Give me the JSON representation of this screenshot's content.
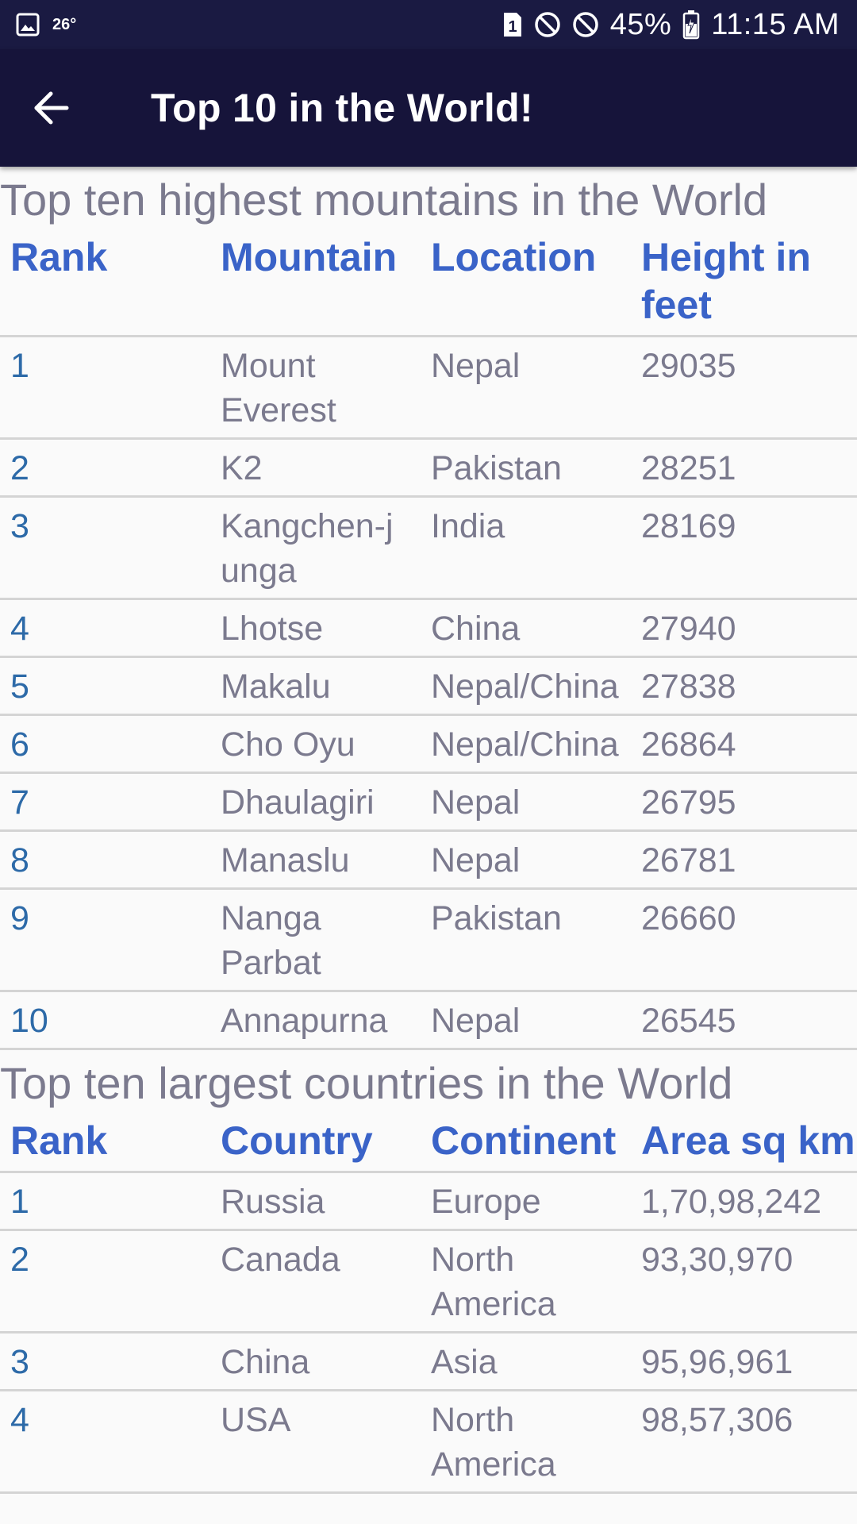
{
  "status_bar": {
    "temperature": "26°",
    "sim_badge": "1",
    "battery": "45%",
    "time": "11:15 AM"
  },
  "app_bar": {
    "title": "Top 10 in the World!"
  },
  "mountains": {
    "title": "Top ten highest mountains in the World",
    "headers": [
      "Rank",
      "Mountain",
      "Location",
      "Height in feet"
    ],
    "rows": [
      [
        "1",
        "Mount Everest",
        "Nepal",
        "29035"
      ],
      [
        "2",
        "K2",
        "Pakistan",
        "28251"
      ],
      [
        "3",
        "Kangchen-junga",
        "India",
        "28169"
      ],
      [
        "4",
        "Lhotse",
        "China",
        "27940"
      ],
      [
        "5",
        "Makalu",
        "Nepal/China",
        "27838"
      ],
      [
        "6",
        "Cho Oyu",
        "Nepal/China",
        "26864"
      ],
      [
        "7",
        "Dhaulagiri",
        "Nepal",
        "26795"
      ],
      [
        "8",
        "Manaslu",
        "Nepal",
        "26781"
      ],
      [
        "9",
        "Nanga Parbat",
        "Pakistan",
        "26660"
      ],
      [
        "10",
        "Annapurna",
        "Nepal",
        "26545"
      ]
    ]
  },
  "countries": {
    "title": "Top ten largest countries in the World",
    "headers": [
      "Rank",
      "Country",
      "Continent",
      "Area sq km"
    ],
    "rows": [
      [
        "1",
        "Russia",
        "Europe",
        "1,70,98,242"
      ],
      [
        "2",
        "Canada",
        "North America",
        "93,30,970"
      ],
      [
        "3",
        "China",
        "Asia",
        "95,96,961"
      ],
      [
        "4",
        "USA",
        "North America",
        "98,57,306"
      ]
    ]
  }
}
